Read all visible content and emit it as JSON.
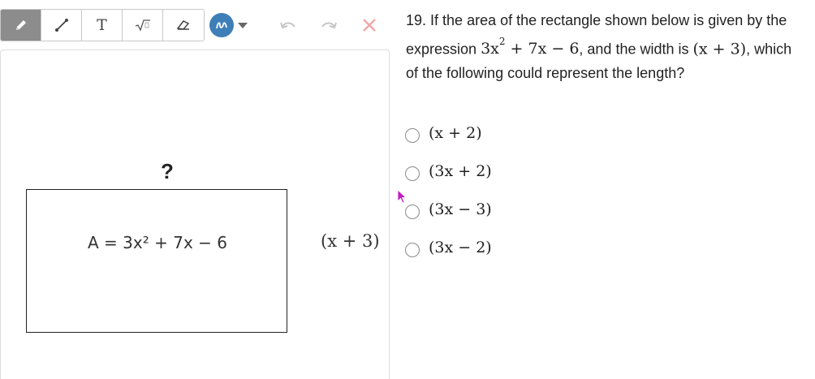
{
  "toolbar": {
    "tools": [
      {
        "name": "pencil",
        "icon": "pencil-icon",
        "active": true
      },
      {
        "name": "line",
        "icon": "line-icon",
        "active": false
      },
      {
        "name": "text",
        "icon": "text-icon",
        "label": "T",
        "active": false
      },
      {
        "name": "equation",
        "icon": "sqrt-icon",
        "active": false
      },
      {
        "name": "eraser",
        "icon": "eraser-icon",
        "active": false
      }
    ],
    "color": "#3f7fb8",
    "undo_icon": "undo-icon",
    "redo_icon": "redo-icon",
    "clear_icon": "close-icon"
  },
  "figure": {
    "unknown_label": "?",
    "area_label": "A = 3x² + 7x − 6",
    "width_label": "(x + 3)"
  },
  "question": {
    "number": "19.",
    "text_before": "If the area of the rectangle shown below is given by the expression",
    "expression": "3x",
    "expression_exp": "2",
    "expression_rest": " + 7x − 6",
    "text_middle": ", and the width is",
    "width_expr": "(x + 3)",
    "text_after": ", which of the following could represent the length?"
  },
  "choices": [
    {
      "label": "(x + 2)"
    },
    {
      "label": "(3x + 2)"
    },
    {
      "label": "(3x − 3)"
    },
    {
      "label": "(3x − 2)"
    }
  ]
}
